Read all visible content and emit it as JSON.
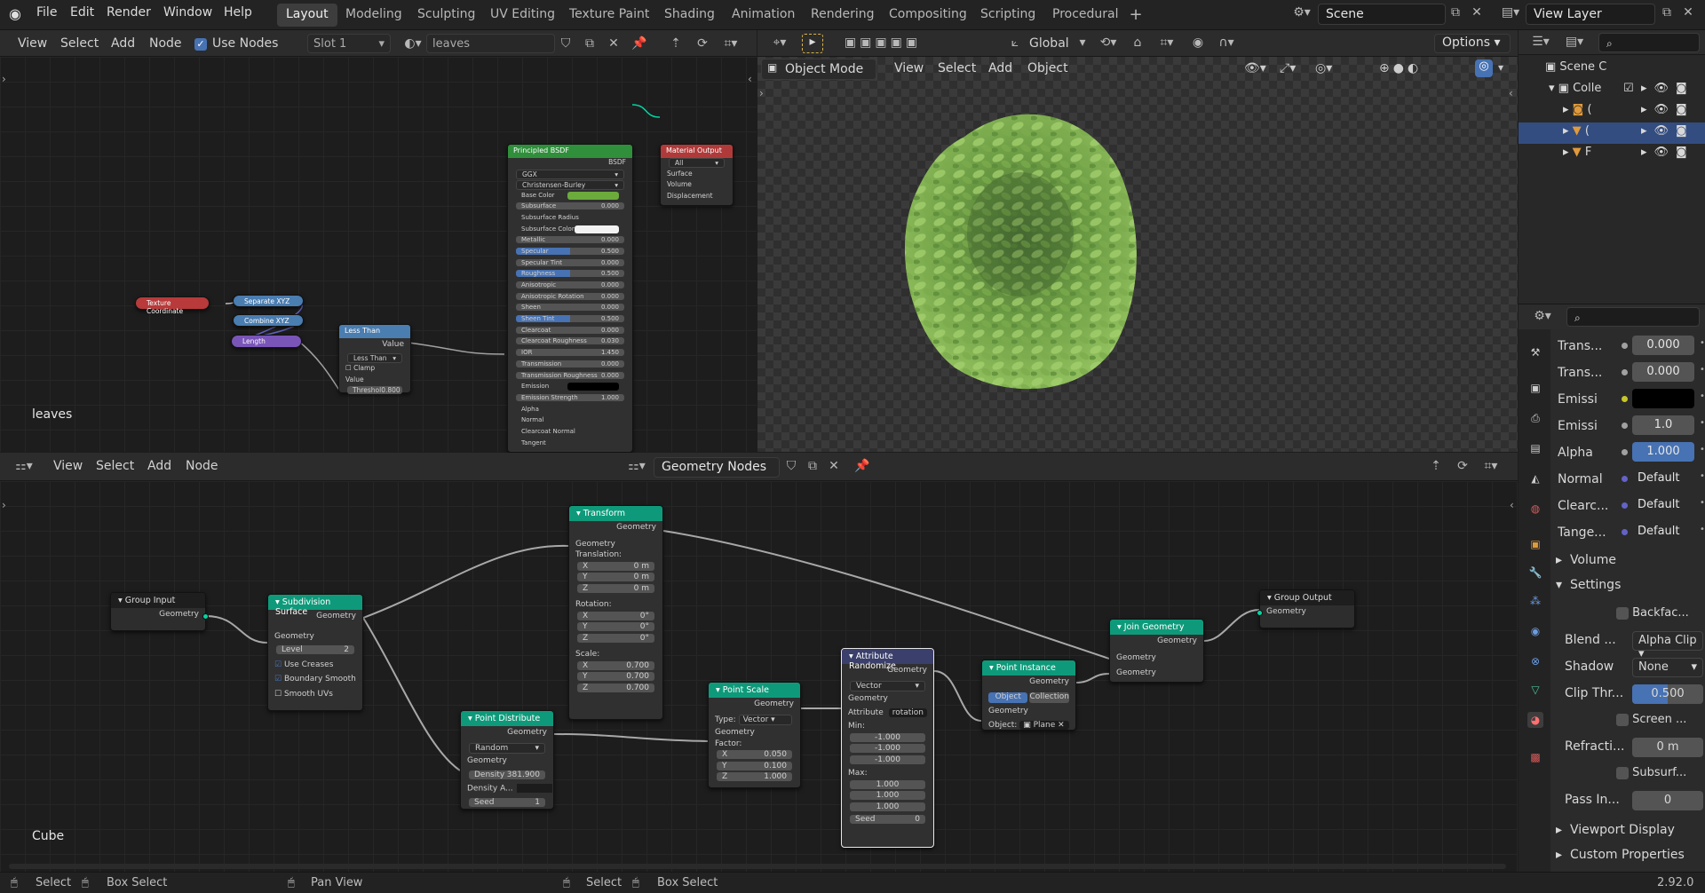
{
  "topbar": {
    "menus": [
      "File",
      "Edit",
      "Render",
      "Window",
      "Help"
    ],
    "workspaces": [
      "Layout",
      "Modeling",
      "Sculpting",
      "UV Editing",
      "Texture Paint",
      "Shading",
      "Animation",
      "Rendering",
      "Compositing",
      "Scripting",
      "Procedural"
    ],
    "active_workspace": "Layout",
    "scene_name": "Scene",
    "view_layer": "View Layer"
  },
  "shader_editor": {
    "header": {
      "view": "View",
      "select": "Select",
      "add": "Add",
      "node": "Node",
      "use_nodes": "Use Nodes",
      "slot": "Slot 1",
      "material": "leaves"
    },
    "label": "leaves",
    "nodes": {
      "texcoord": "Texture Coordinate",
      "separate": "Separate XYZ",
      "combine": "Combine XYZ",
      "length": "Length",
      "lessthan": {
        "title": "Less Than",
        "out": "Value",
        "op": "Less Than",
        "clamp": "Clamp",
        "value_in": "Value",
        "threshold_label": "Threshol",
        "threshold": "0.800"
      },
      "bsdf": {
        "title": "Principled BSDF",
        "out": "BSDF",
        "dist": "GGX",
        "sss": "Christensen-Burley",
        "inputs": [
          {
            "label": "Base Color",
            "value": ""
          },
          {
            "label": "Subsurface",
            "value": "0.000"
          },
          {
            "label": "Subsurface Radius",
            "value": ""
          },
          {
            "label": "Subsurface Color",
            "value": ""
          },
          {
            "label": "Metallic",
            "value": "0.000"
          },
          {
            "label": "Specular",
            "value": "0.500"
          },
          {
            "label": "Specular Tint",
            "value": "0.000"
          },
          {
            "label": "Roughness",
            "value": "0.500"
          },
          {
            "label": "Anisotropic",
            "value": "0.000"
          },
          {
            "label": "Anisotropic Rotation",
            "value": "0.000"
          },
          {
            "label": "Sheen",
            "value": "0.000"
          },
          {
            "label": "Sheen Tint",
            "value": "0.500"
          },
          {
            "label": "Clearcoat",
            "value": "0.000"
          },
          {
            "label": "Clearcoat Roughness",
            "value": "0.030"
          },
          {
            "label": "IOR",
            "value": "1.450"
          },
          {
            "label": "Transmission",
            "value": "0.000"
          },
          {
            "label": "Transmission Roughness",
            "value": "0.000"
          },
          {
            "label": "Emission",
            "value": ""
          },
          {
            "label": "Emission Strength",
            "value": "1.000"
          },
          {
            "label": "Alpha",
            "value": ""
          },
          {
            "label": "Normal",
            "value": ""
          },
          {
            "label": "Clearcoat Normal",
            "value": ""
          },
          {
            "label": "Tangent",
            "value": ""
          }
        ]
      },
      "matout": {
        "title": "Material Output",
        "target": "All",
        "inputs": [
          "Surface",
          "Volume",
          "Displacement"
        ]
      }
    }
  },
  "viewport": {
    "mode": "Object Mode",
    "view": "View",
    "select": "Select",
    "add": "Add",
    "object": "Object",
    "orientation": "Global",
    "options": "Options"
  },
  "outliner": {
    "scene_collection": "Scene C",
    "collection": "Colle",
    "items": [
      "(",
      "(",
      "F"
    ]
  },
  "properties": {
    "rows": [
      {
        "label": "Trans...",
        "value": "0.000"
      },
      {
        "label": "Trans...",
        "value": "0.000"
      },
      {
        "label": "Emissi",
        "value": ""
      },
      {
        "label": "Emissi",
        "value": "1.0"
      },
      {
        "label": "Alpha",
        "value": "1.000"
      },
      {
        "label": "Normal",
        "value": "Default"
      },
      {
        "label": "Clearc...",
        "value": "Default"
      },
      {
        "label": "Tange...",
        "value": "Default"
      }
    ],
    "volume": "Volume",
    "settings": "Settings",
    "backface": "Backfac...",
    "blend_label": "Blend ...",
    "blend_value": "Alpha Clip",
    "shadow_label": "Shadow",
    "shadow_value": "None",
    "clip_label": "Clip Thr...",
    "clip_value": "0.500",
    "screen": "Screen ...",
    "refraction_label": "Refracti...",
    "refraction_value": "0 m",
    "subsurf": "Subsurf...",
    "pass_label": "Pass In...",
    "pass_value": "0",
    "viewport_display": "Viewport Display",
    "custom_props": "Custom Properties"
  },
  "geo_editor": {
    "header": {
      "view": "View",
      "select": "Select",
      "add": "Add",
      "node": "Node",
      "tree": "Geometry Nodes"
    },
    "label": "Cube",
    "nodes": {
      "group_input": {
        "title": "Group Input",
        "out": "Geometry"
      },
      "subdiv": {
        "title": "Subdivision Surface",
        "out": "Geometry",
        "in": "Geometry",
        "level_label": "Level",
        "level": "2",
        "creases": "Use Creases",
        "boundary": "Boundary Smooth",
        "smooth_uvs": "Smooth UVs"
      },
      "transform": {
        "title": "Transform",
        "out": "Geometry",
        "in": "Geometry",
        "translation": "Translation:",
        "rotation": "Rotation:",
        "scale": "Scale:",
        "t": [
          {
            "axis": "X",
            "v": "0 m"
          },
          {
            "axis": "Y",
            "v": "0 m"
          },
          {
            "axis": "Z",
            "v": "0 m"
          }
        ],
        "r": [
          {
            "axis": "X",
            "v": "0°"
          },
          {
            "axis": "Y",
            "v": "0°"
          },
          {
            "axis": "Z",
            "v": "0°"
          }
        ],
        "s": [
          {
            "axis": "X",
            "v": "0.700"
          },
          {
            "axis": "Y",
            "v": "0.700"
          },
          {
            "axis": "Z",
            "v": "0.700"
          }
        ]
      },
      "distribute": {
        "title": "Point Distribute",
        "out": "Geometry",
        "mode": "Random",
        "in": "Geometry",
        "density_label": "Density",
        "density": "381.900",
        "density_attr": "Density A...",
        "seed_label": "Seed",
        "seed": "1"
      },
      "pscale": {
        "title": "Point Scale",
        "out": "Geometry",
        "type_label": "Type:",
        "type": "Vector",
        "in": "Geometry",
        "factor": "Factor:",
        "f": [
          {
            "axis": "X",
            "v": "0.050"
          },
          {
            "axis": "Y",
            "v": "0.100"
          },
          {
            "axis": "Z",
            "v": "1.000"
          }
        ]
      },
      "attrrand": {
        "title": "Attribute Randomize",
        "out": "Geometry",
        "type": "Vector",
        "in": "Geometry",
        "attr_label": "Attribute",
        "attr": "rotation",
        "min": "Min:",
        "max": "Max:",
        "minv": [
          "-1.000",
          "-1.000",
          "-1.000"
        ],
        "maxv": [
          "1.000",
          "1.000",
          "1.000"
        ],
        "seed_label": "Seed",
        "seed": "0"
      },
      "instance": {
        "title": "Point Instance",
        "out": "Geometry",
        "tab1": "Object",
        "tab2": "Collection",
        "in": "Geometry",
        "obj_label": "Object:",
        "obj": "Plane"
      },
      "join": {
        "title": "Join Geometry",
        "out": "Geometry",
        "in1": "Geometry",
        "in2": "Geometry"
      },
      "group_output": {
        "title": "Group Output",
        "in": "Geometry"
      }
    }
  },
  "statusbar": {
    "select": "Select",
    "box_select": "Box Select",
    "pan_view": "Pan View",
    "select2": "Select",
    "box_select2": "Box Select",
    "version": "2.92.0"
  },
  "colors": {
    "accent": "#4772b3",
    "geo_header": "#0e9a7a",
    "shader_header": "#2f8f3b",
    "output_header": "#b03a3a"
  }
}
